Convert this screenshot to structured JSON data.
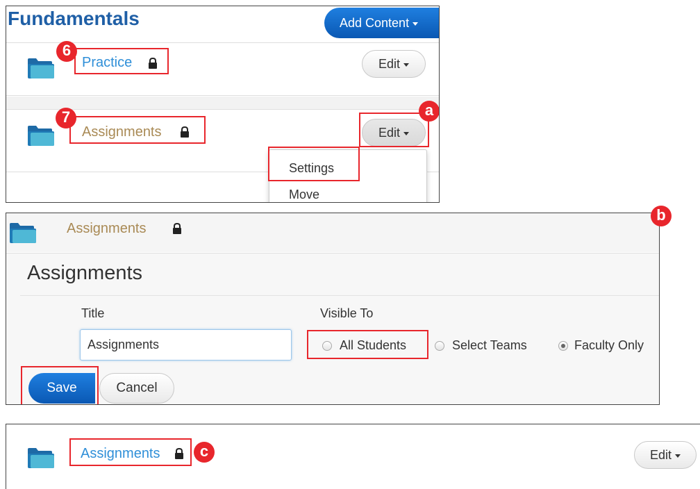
{
  "panel1": {
    "page_title": "Fundamentals",
    "add_content_label": "Add Content",
    "items": [
      {
        "label": "Practice",
        "badge": "6"
      },
      {
        "label": "Assignments",
        "badge": "7"
      }
    ],
    "edit_label": "Edit",
    "step_a": "a",
    "dropdown": [
      "Settings",
      "Move"
    ]
  },
  "panel2": {
    "folder_label": "Assignments",
    "step_b": "b",
    "form_heading": "Assignments",
    "title_label": "Title",
    "title_value": "Assignments",
    "visible_to_label": "Visible To",
    "options": [
      "All Students",
      "Select Teams",
      "Faculty Only"
    ],
    "selected_option": "Faculty Only",
    "save_label": "Save",
    "cancel_label": "Cancel"
  },
  "panel3": {
    "folder_label": "Assignments",
    "step_c": "c",
    "edit_label": "Edit"
  },
  "colors": {
    "title_blue": "#1f5fa6",
    "link_blue": "#2f8fd8",
    "link_gold": "#a98a55",
    "primary_blue": "#0a63c9",
    "highlight_red": "#e8262c",
    "folder_teal": "#4fb8d6"
  },
  "icons": [
    "folder-icon",
    "lock-icon",
    "chevron-down-icon"
  ]
}
